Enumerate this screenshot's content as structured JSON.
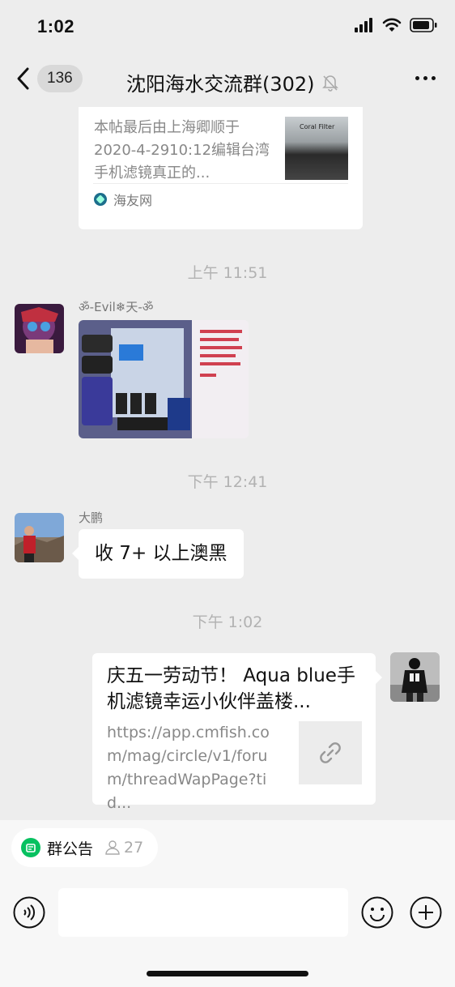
{
  "status_bar": {
    "time": "1:02"
  },
  "nav": {
    "badge_count": "136",
    "title": "沈阳海水交流群(302)"
  },
  "messages": {
    "top_card": {
      "description": "本帖最后由上海卿顺于2020-4-2910:12编辑台湾手机滤镜真正的...",
      "thumb_text": "Coral Filter",
      "source": "海友网"
    },
    "time1": "上午 11:51",
    "sender1": "ॐ-Evil❄天-ॐ",
    "time2": "下午 12:41",
    "sender2": "大鹏",
    "text2": "收 7+ 以上澳黑",
    "time3": "下午 1:02",
    "link_card": {
      "title": "庆五一劳动节！ Aqua blue手机滤镜幸运小伙伴盖楼...",
      "url": "https://app.cmfish.com/mag/circle/v1/forum/threadWapPage?tid..."
    }
  },
  "bottom": {
    "notice_label": "群公告",
    "notice_count": "27"
  },
  "colors": {
    "accent_green": "#07c160",
    "timestamp_gray": "#b2b2b2"
  },
  "icons": [
    "signal-icon",
    "wifi-icon",
    "battery-icon",
    "back-chevron-icon",
    "mute-bell-icon",
    "more-icon",
    "link-icon",
    "notice-icon",
    "person-icon",
    "voice-icon",
    "emoji-icon",
    "plus-icon"
  ]
}
